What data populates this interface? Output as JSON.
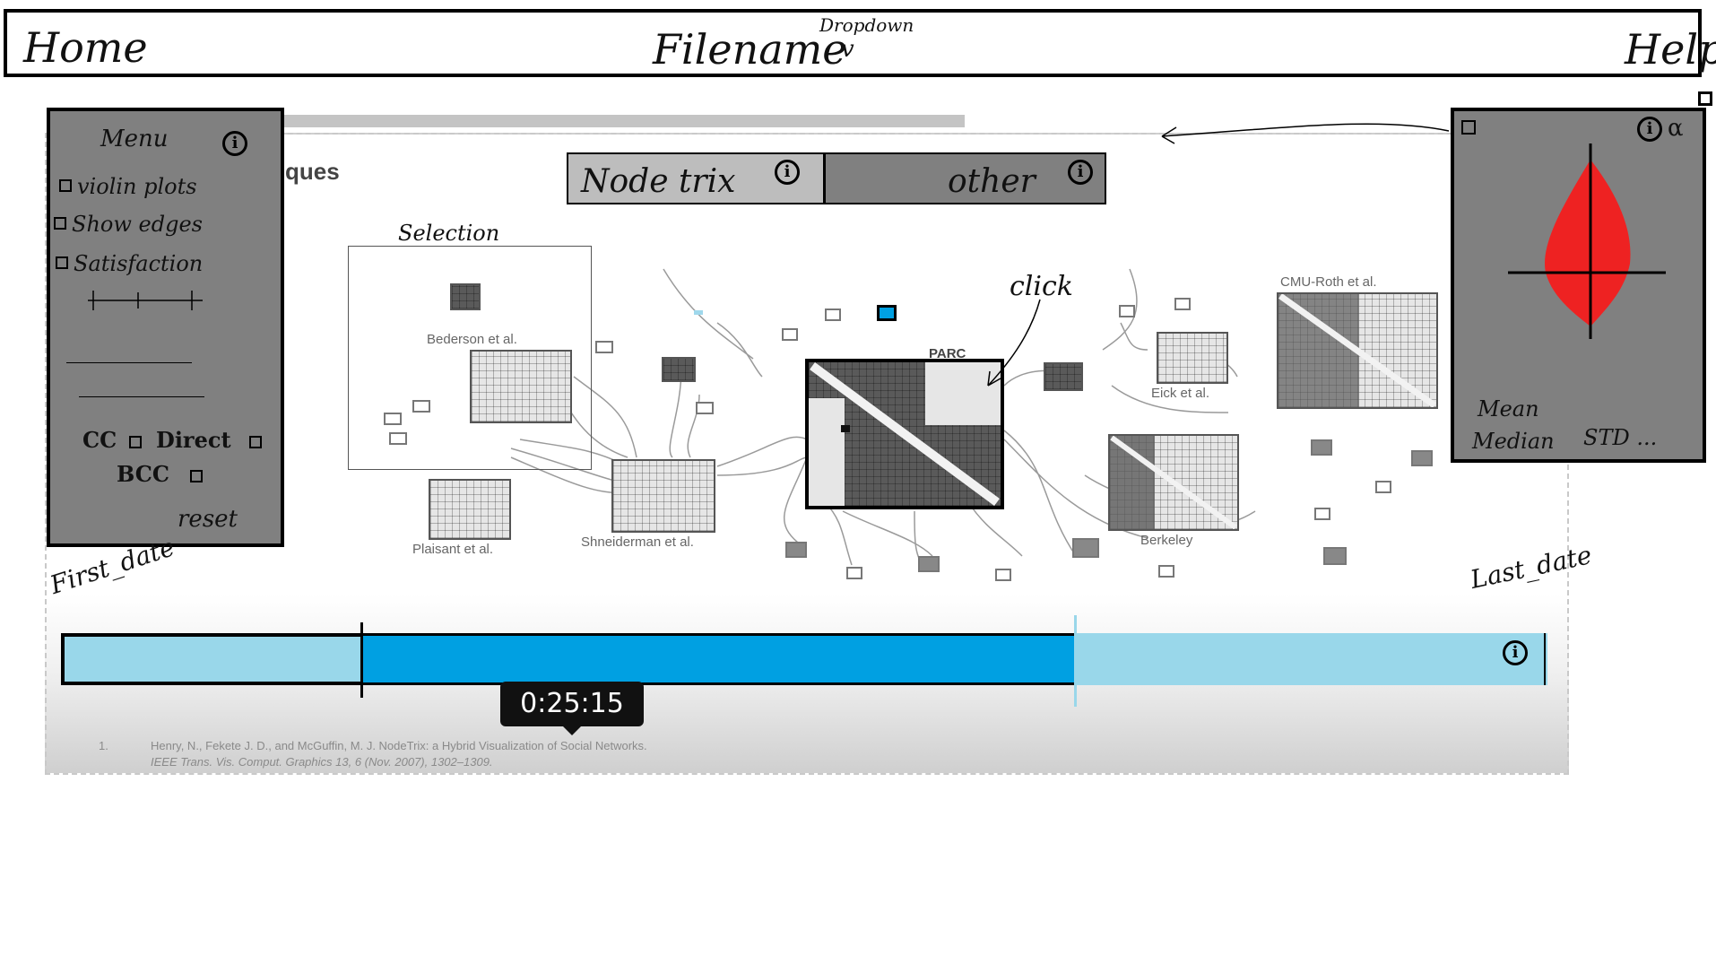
{
  "topbar": {
    "home": "Home",
    "filename": "Filename",
    "dropdown_label": "Dropdown",
    "dropdown_mark": "v",
    "help": "Help"
  },
  "menu": {
    "title": "Menu",
    "options": [
      "violin plots",
      "Show edges",
      "Satisfaction"
    ],
    "cc": "CC",
    "direct": "Direct",
    "bcc": "BCC",
    "reset": "reset"
  },
  "tabs": [
    {
      "label": "Node trix"
    },
    {
      "label": "other"
    }
  ],
  "canvas": {
    "partial_heading": "ques",
    "selection_label": "Selection",
    "click_annotation": "click",
    "node_labels": {
      "bederson": "Bederson et al.",
      "plaisant": "Plaisant et al.",
      "shneiderman": "Shneiderman et al.",
      "parc": "PARC",
      "eick": "Eick et al.",
      "berkeley": "Berkeley",
      "cmu": "CMU-Roth et al."
    },
    "reference_number": "1.",
    "reference_line1": "Henry, N., Fekete J. D., and McGuffin, M. J. NodeTrix: a Hybrid Visualization of Social Networks.",
    "reference_line2": "IEEE Trans. Vis. Comput. Graphics 13, 6 (Nov. 2007), 1302–1309."
  },
  "viz_panel": {
    "mean": "Mean",
    "median": "Median",
    "std": "STD ...",
    "shape_color": "#ee2222"
  },
  "timeline": {
    "first_date": "First_date",
    "last_date": "Last_date",
    "time": "0:25:15",
    "range_color": "#00a0e2",
    "track_color": "#99d7ea"
  }
}
